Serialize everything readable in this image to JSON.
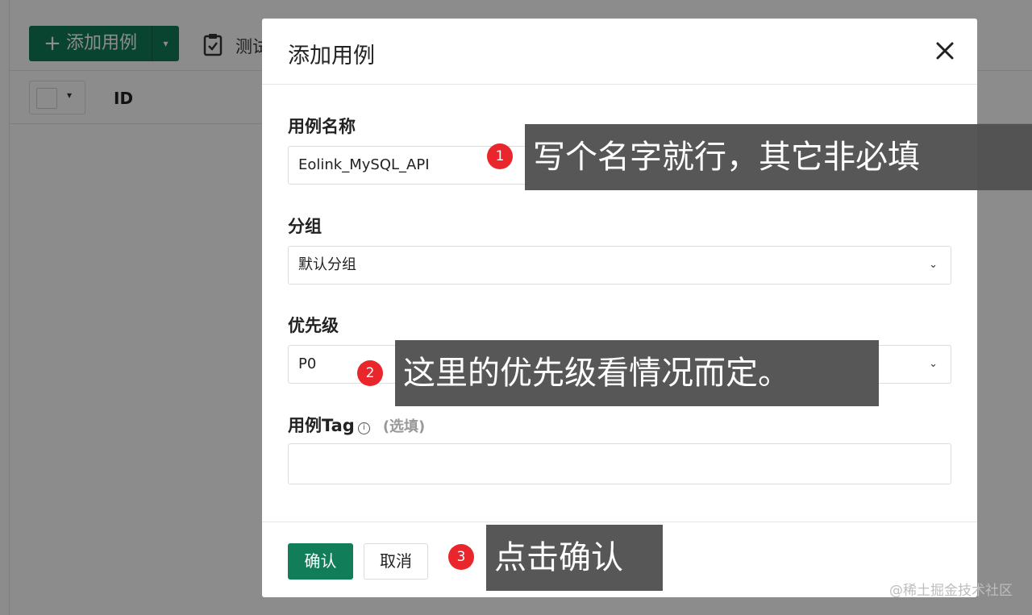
{
  "background": {
    "add_button_label": "添加用例",
    "test_label": "测试",
    "table_id_header": "ID"
  },
  "modal": {
    "title": "添加用例",
    "fields": {
      "case_name": {
        "label": "用例名称",
        "value": "Eolink_MySQL_API"
      },
      "group": {
        "label": "分组",
        "value": "默认分组"
      },
      "priority": {
        "label": "优先级",
        "value": "P0"
      },
      "tag": {
        "label": "用例Tag",
        "optional_note": "(选填)",
        "value": ""
      }
    },
    "confirm_label": "确认",
    "cancel_label": "取消"
  },
  "annotations": [
    {
      "number": "1",
      "text": "写个名字就行，其它非必填"
    },
    {
      "number": "2",
      "text": "这里的优先级看情况而定。"
    },
    {
      "number": "3",
      "text": "点击确认"
    }
  ],
  "watermark": "@稀土掘金技术社区",
  "colors": {
    "accent": "#117d59",
    "badge": "#e8262b",
    "callout": "#505050"
  }
}
